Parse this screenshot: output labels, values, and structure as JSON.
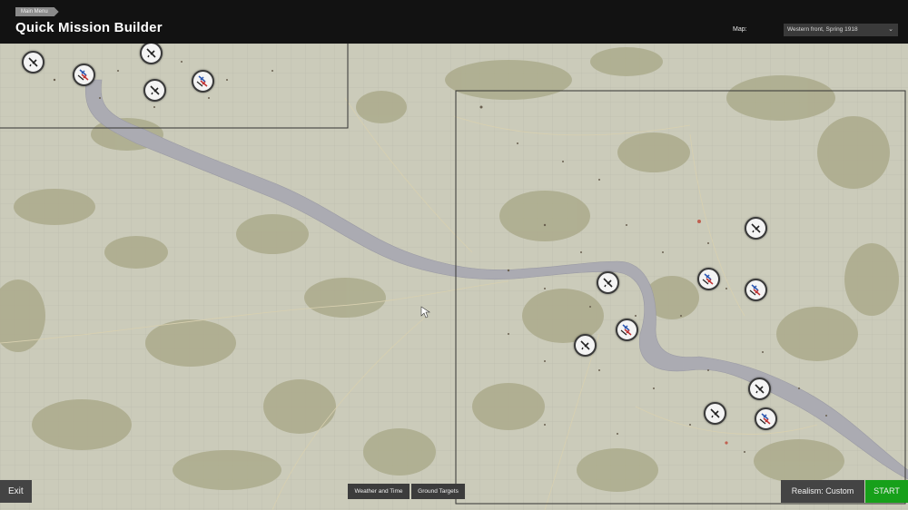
{
  "header": {
    "breadcrumb": "Main Menu",
    "title": "Quick Mission Builder",
    "map_label": "Map:",
    "map_value": "Western front, Spring 1918"
  },
  "markers": [
    {
      "kind": "single",
      "icon": "single-plane-icon"
    },
    {
      "kind": "group",
      "icon": "plane-group-icon"
    },
    {
      "kind": "single",
      "icon": "single-plane-icon"
    },
    {
      "kind": "group",
      "icon": "plane-group-icon"
    },
    {
      "kind": "single",
      "icon": "single-plane-icon"
    },
    {
      "kind": "single",
      "icon": "single-plane-icon"
    },
    {
      "kind": "single",
      "icon": "single-plane-icon"
    },
    {
      "kind": "group",
      "icon": "plane-group-icon"
    },
    {
      "kind": "group",
      "icon": "plane-group-icon"
    },
    {
      "kind": "group",
      "icon": "plane-group-icon"
    },
    {
      "kind": "single",
      "icon": "single-plane-icon"
    },
    {
      "kind": "single",
      "icon": "single-plane-icon"
    },
    {
      "kind": "single",
      "icon": "single-plane-icon"
    },
    {
      "kind": "group",
      "icon": "plane-group-icon"
    }
  ],
  "footer": {
    "exit_label": "Exit",
    "weather_label": "Weather and Time",
    "targets_label": "Ground Targets",
    "realism_label": "Realism: Custom",
    "start_label": "START"
  },
  "colors": {
    "topbar": "#121212",
    "map_base": "#c9c9b8",
    "forest": "#aaa98a",
    "river": "#a9a9b0",
    "start": "#17a01a",
    "button": "#444444"
  }
}
